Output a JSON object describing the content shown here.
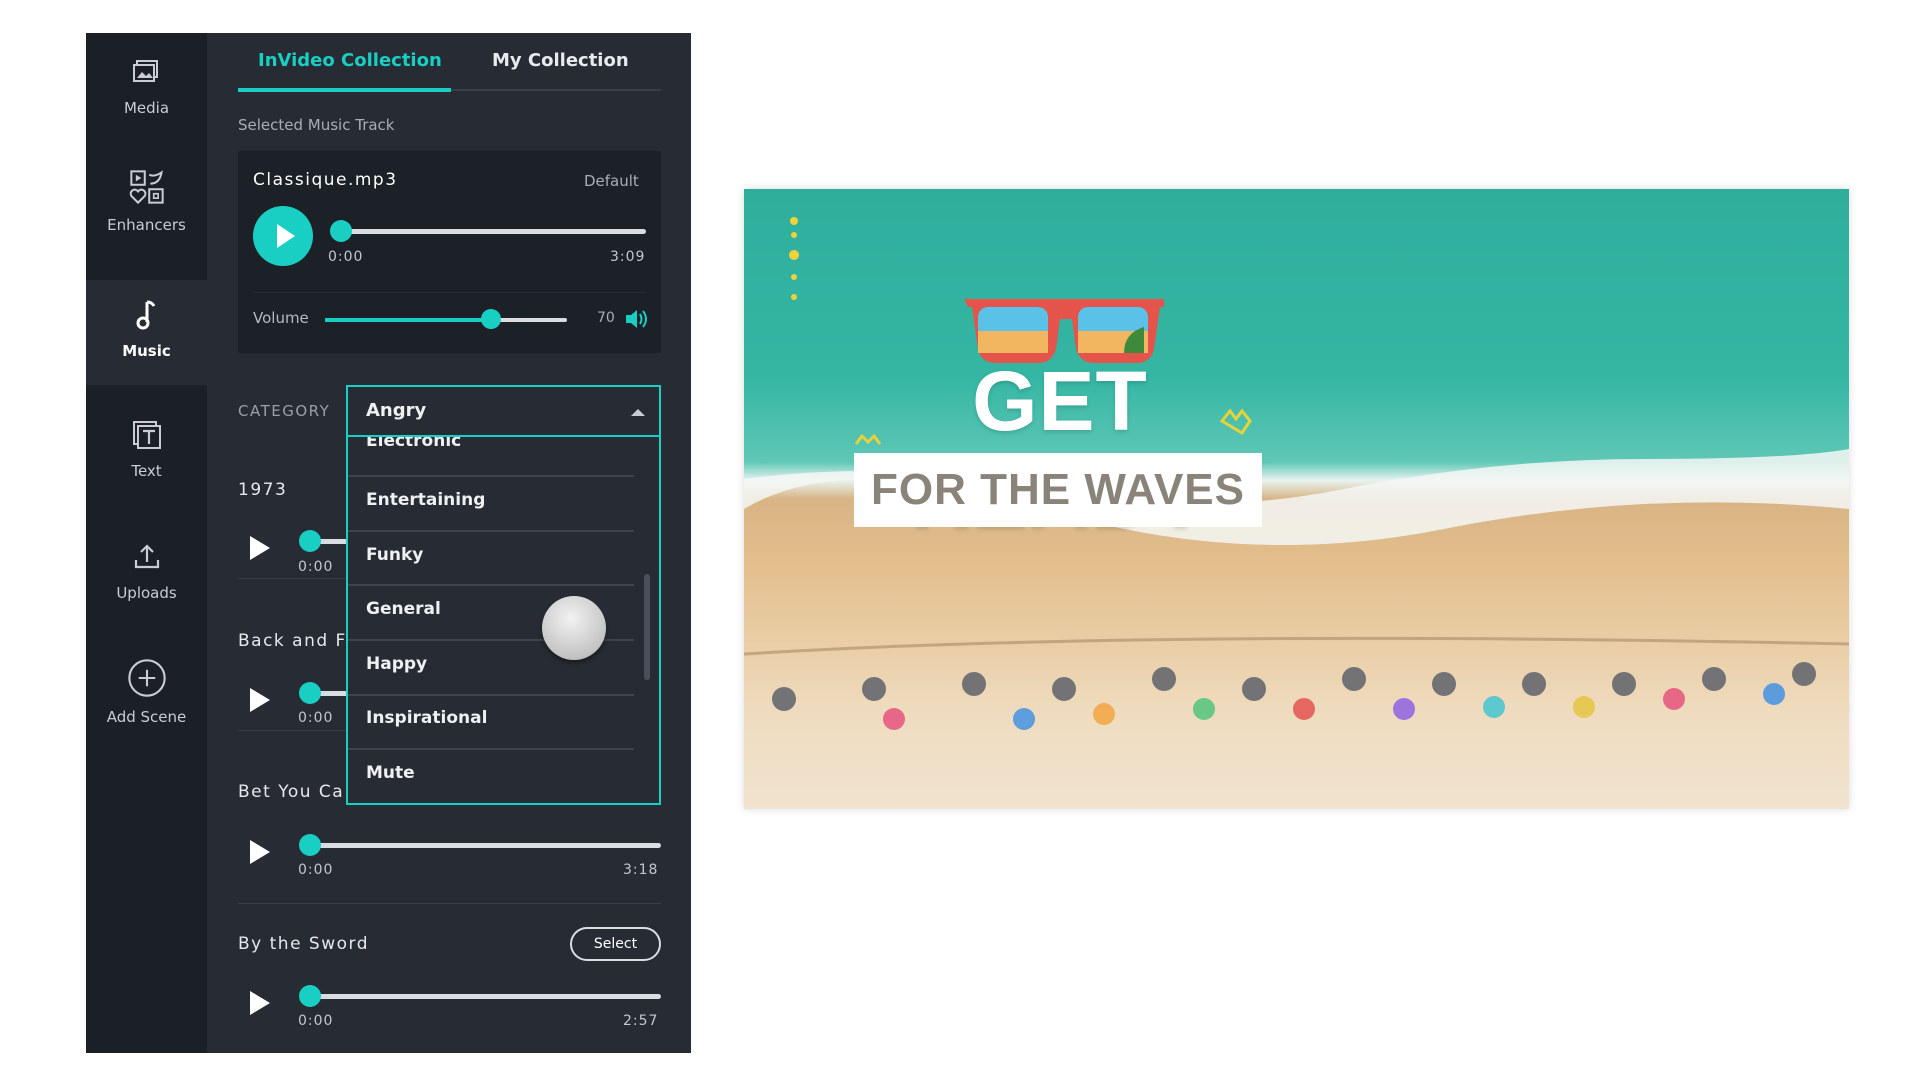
{
  "sidebar": {
    "items": [
      {
        "label": "Media",
        "icon": "media-icon"
      },
      {
        "label": "Enhancers",
        "icon": "enhancers-icon"
      },
      {
        "label": "Music",
        "icon": "music-icon",
        "active": true
      },
      {
        "label": "Text",
        "icon": "text-icon"
      },
      {
        "label": "Uploads",
        "icon": "upload-icon"
      },
      {
        "label": "Add Scene",
        "icon": "plus-circle-icon"
      }
    ]
  },
  "tabs": [
    {
      "label": "InVideo Collection",
      "active": true
    },
    {
      "label": "My Collection"
    }
  ],
  "selected": {
    "heading": "Selected Music Track",
    "file": "Classique.mp3",
    "badge": "Default",
    "current": "0:00",
    "duration": "3:09",
    "progress": 0,
    "volume_label": "Volume",
    "volume": "70",
    "volume_fraction": 0.7
  },
  "category": {
    "label": "CATEGORY",
    "selected": "Angry",
    "options": [
      "Electronic",
      "Entertaining",
      "Funky",
      "General",
      "Happy",
      "Inspirational",
      "Mute"
    ]
  },
  "tracks": [
    {
      "title": "1973",
      "current": "0:00"
    },
    {
      "title": "Back and F",
      "current": "0:00"
    },
    {
      "title": "Bet You Ca",
      "current": "0:00",
      "duration": "3:18"
    },
    {
      "title": "By the Sword",
      "current": "0:00",
      "duration": "2:57",
      "button": "Select"
    }
  ],
  "preview": {
    "headline": "GET READY",
    "subline": "FOR THE WAVES"
  },
  "colors": {
    "accent": "#19cfc4",
    "panel": "#272c34",
    "sidebar": "#1b1f26"
  }
}
